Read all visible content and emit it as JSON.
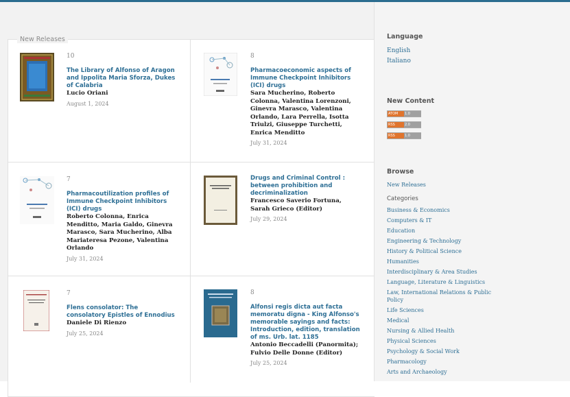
{
  "section_label": "New Releases",
  "books": [
    {
      "count": "10",
      "title": "The Library of Alfonso of Aragon and Ippolita Maria Sforza, Dukes of Calabria",
      "authors": "Lucio Oriani",
      "date": "August 1, 2024"
    },
    {
      "count": "8",
      "title": "Pharmacoeconomic aspects of Immune Checkpoint Inhibitors (ICI) drugs",
      "authors": "Sara Mucherino, Roberto Colonna, Valentina Lorenzoni, Ginevra Marasco, Valentina Orlando, Lara Perrella, Isotta Triulzi, Giuseppe Turchetti, Enrica Menditto",
      "date": "July 31, 2024"
    },
    {
      "count": "7",
      "title": "Pharmacoutilization profiles of Immune Checkpoint Inhibitors (ICI) drugs",
      "authors": "Roberto Colonna, Enrica Menditto, Maria Galdo, Ginevra Marasco, Sara Mucherino, Alba Mariateresa Pezone, Valentina Orlando",
      "date": "July 31, 2024"
    },
    {
      "count": "",
      "title": "Drugs and Criminal Control : between prohibition and decriminalization",
      "authors": "Francesco Saverio Fortuna, Sarah Grieco (Editor)",
      "date": "July 29, 2024"
    },
    {
      "count": "7",
      "title": "Flens consolator: The consolatory Epistles of Ennodius",
      "authors": "Daniele Di Rienzo",
      "date": "July 25, 2024"
    },
    {
      "count": "8",
      "title": "Alfonsi regis dicta aut facta memoratu digna - King Alfonso's memorable sayings and facts: Introduction, edition, translation of ms. Urb. lat. 1185",
      "authors": "Antonio Beccadelli (Panormita); Fulvio Delle Donne (Editor)",
      "date": "July 25, 2024"
    }
  ],
  "sidebar": {
    "language_heading": "Language",
    "languages": [
      "English",
      "Italiano"
    ],
    "new_content_heading": "New Content",
    "feeds": [
      {
        "left": "ATOM",
        "right": "1.0"
      },
      {
        "left": "RSS",
        "right": "2.0"
      },
      {
        "left": "RSS",
        "right": "1.0"
      }
    ],
    "browse_heading": "Browse",
    "browse_link": "New Releases",
    "categories_heading": "Categories",
    "categories": [
      "Business & Economics",
      "Computers & IT",
      "Education",
      "Engineering & Technology",
      "History & Political Science",
      "Humanities",
      "Interdisciplinary & Area Studies",
      "Language, Literature & Linguistics",
      "Law, International Relations & Public Policy",
      "Life Sciences",
      "Medical",
      "Nursing & Allied Health",
      "Physical Sciences",
      "Psychology & Social Work",
      "Pharmacology",
      "Arts and Archaeology"
    ]
  }
}
